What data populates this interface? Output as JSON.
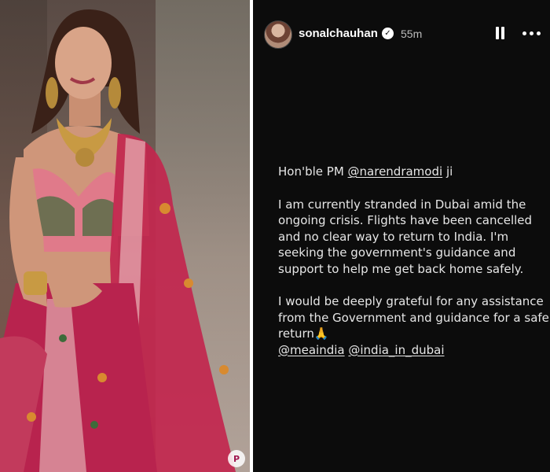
{
  "photo": {
    "alt": "Woman in pink embroidered lehenga with gold jewelry",
    "watermark": "P"
  },
  "story": {
    "username": "sonalchauhan",
    "time": "55m",
    "greeting_prefix": "Hon'ble PM ",
    "greeting_mention": "@narendramodi",
    "greeting_suffix": " ji",
    "paragraph1": "I am currently stranded in Dubai amid the ongoing crisis. Flights have been cancelled and no clear way  to return to India. I'm seeking the government's guidance and support to help me get back home safely.",
    "paragraph2": "I would be deeply grateful for any assistance from the Government and guidance for a safe return🙏",
    "mention1": "@meaindia",
    "mention2": "@india_in_dubai"
  }
}
